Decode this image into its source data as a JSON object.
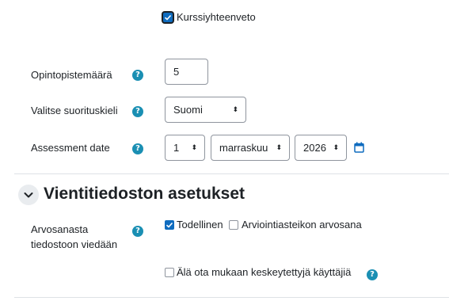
{
  "course_summary": {
    "label": "Kurssiyhteenveto",
    "checked": true
  },
  "credits": {
    "label": "Opintopistemäärä",
    "value": "5"
  },
  "language": {
    "label": "Valitse suorituskieli",
    "selected": "Suomi"
  },
  "assessment_date": {
    "label": "Assessment date",
    "day": "1",
    "month": "marraskuu",
    "year": "2026"
  },
  "export_section": {
    "title": "Vientitiedoston asetukset",
    "grade_export": {
      "label_line1": "Arvosanasta",
      "label_line2": "tiedostoon viedään",
      "option_real": "Todellinen",
      "option_real_checked": true,
      "option_scale": "Arviointiasteikon arvosana",
      "option_scale_checked": false
    },
    "exclude_suspended": {
      "label": "Älä ota mukaan keskeytettyjä käyttäjiä",
      "checked": false
    }
  },
  "icons": {
    "help": "help-question-icon",
    "calendar": "calendar-icon",
    "collapse": "chevron-down-icon",
    "caret": "select-caret-icon"
  },
  "colors": {
    "accent": "#0f6cbf",
    "help": "#1a8fb3",
    "text": "#1d2125"
  }
}
